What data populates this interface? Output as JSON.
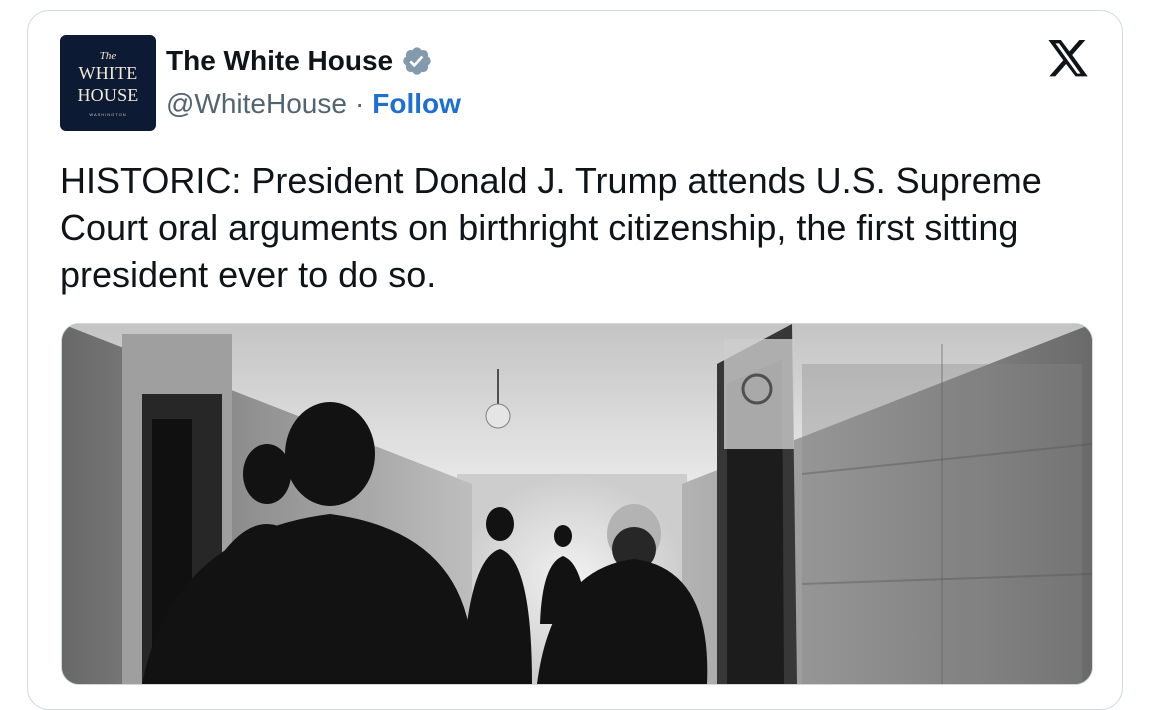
{
  "tweet": {
    "author": {
      "display_name": "The White House",
      "handle": "@WhiteHouse",
      "separator": "·",
      "follow_label": "Follow",
      "avatar": {
        "line1": "The",
        "line2": "WHITE",
        "line3": "HOUSE",
        "line4": "WASHINGTON"
      },
      "verified_icon": "verified-badge-icon"
    },
    "platform_icon": "x-logo-icon",
    "text": "HISTORIC: President Donald J. Trump attends U.S. Supreme Court oral arguments on birthright citizenship, the first sitting president ever to do so.",
    "media": {
      "type": "photo",
      "style": "black-and-white"
    }
  },
  "colors": {
    "text": "#0f1419",
    "secondary_text": "#536471",
    "link": "#1d6fd1",
    "border": "#cfd9de",
    "verified": "#829aab",
    "avatar_bg": "#0d1a33"
  }
}
